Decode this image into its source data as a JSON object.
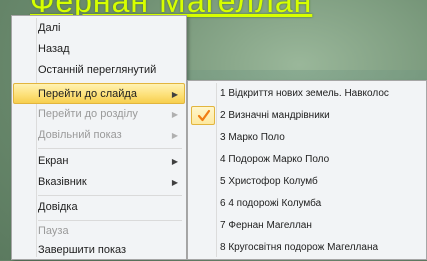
{
  "slide": {
    "title_fragment": "Фернан Магеллан"
  },
  "menu": {
    "items": [
      {
        "label": "Далі",
        "disabled": false,
        "submenu": false
      },
      {
        "label": "Назад",
        "disabled": false,
        "submenu": false
      },
      {
        "label": "Останній переглянутий",
        "disabled": false,
        "submenu": false
      },
      {
        "label": "Перейти до слайда",
        "disabled": false,
        "submenu": true,
        "highlighted": true
      },
      {
        "label": "Перейти до розділу",
        "disabled": true,
        "submenu": true
      },
      {
        "label": "Довільний показ",
        "disabled": true,
        "submenu": true
      },
      {
        "label": "Екран",
        "disabled": false,
        "submenu": true
      },
      {
        "label": "Вказівник",
        "disabled": false,
        "submenu": true
      },
      {
        "label": "Довідка",
        "disabled": false,
        "submenu": false
      },
      {
        "label": "Пауза",
        "disabled": true,
        "submenu": false
      },
      {
        "label": "Завершити показ",
        "disabled": false,
        "submenu": false
      }
    ]
  },
  "submenu": {
    "items": [
      {
        "label": "1 Відкриття нових земель. Навколос",
        "checked": false
      },
      {
        "label": "2 Визначні мандрівники",
        "checked": true
      },
      {
        "label": "3 Марко Поло",
        "checked": false
      },
      {
        "label": "4 Подорож Марко Поло",
        "checked": false
      },
      {
        "label": "5 Христофор Колумб",
        "checked": false
      },
      {
        "label": "6 4 подорожі Колумба",
        "checked": false
      },
      {
        "label": "7 Фернан Магеллан",
        "checked": false
      },
      {
        "label": "8 Кругосвітня подорож Магеллана",
        "checked": false
      }
    ]
  },
  "colors": {
    "highlight": "#fde17b",
    "check": "#f07d14",
    "title": "#d7ff00"
  },
  "icons": {
    "submenu_arrow": "chevron-right-icon",
    "checked": "checkmark-icon"
  }
}
